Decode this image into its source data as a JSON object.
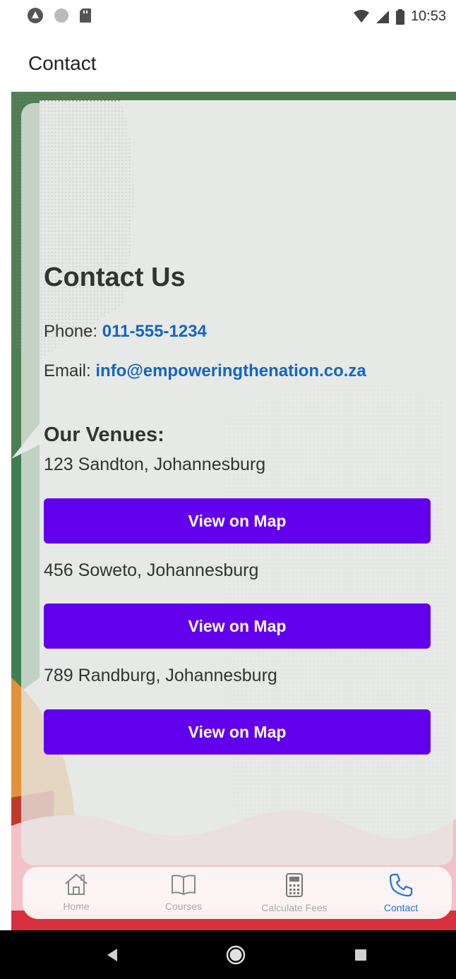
{
  "status_bar": {
    "time": "10:53"
  },
  "app_bar": {
    "title": "Contact"
  },
  "contact": {
    "heading": "Contact Us",
    "phone_label": "Phone:",
    "phone_value": "011-555-1234",
    "email_label": "Email:",
    "email_value": "info@empoweringthenation.co.za",
    "venues_title": "Our Venues:",
    "venues": [
      {
        "address": "123 Sandton, Johannesburg",
        "button": "View on Map"
      },
      {
        "address": "456 Soweto, Johannesburg",
        "button": "View on Map"
      },
      {
        "address": "789 Randburg, Johannesburg",
        "button": "View on Map"
      }
    ]
  },
  "bottom_nav": {
    "items": [
      {
        "label": "Home",
        "icon": "home-icon",
        "active": false
      },
      {
        "label": "Courses",
        "icon": "book-icon",
        "active": false
      },
      {
        "label": "Calculate Fees",
        "icon": "calculator-icon",
        "active": false
      },
      {
        "label": "Contact",
        "icon": "phone-icon",
        "active": true
      }
    ]
  },
  "colors": {
    "button": "#6200ee",
    "link": "#1565c0",
    "active_tab": "#1e73d9"
  }
}
